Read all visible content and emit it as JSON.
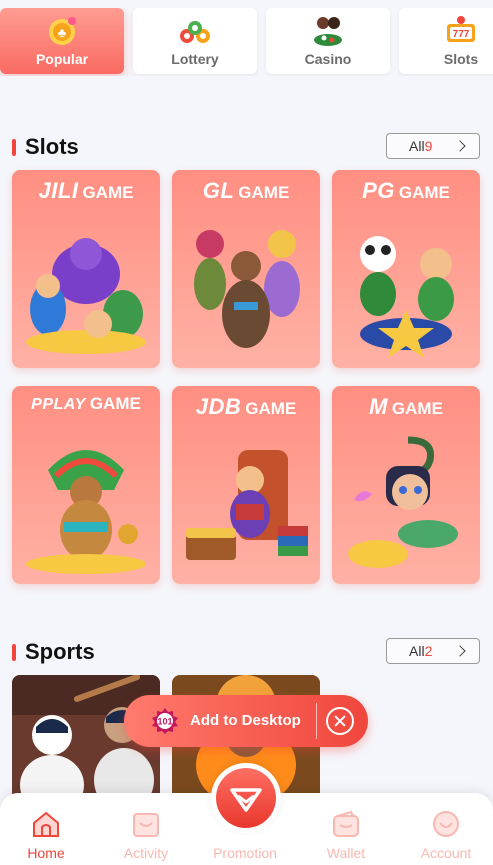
{
  "categories": [
    {
      "label": "Popular",
      "icon": "popular-icon",
      "active": true
    },
    {
      "label": "Lottery",
      "icon": "lottery-icon",
      "active": false
    },
    {
      "label": "Casino",
      "icon": "casino-icon",
      "active": false
    },
    {
      "label": "Slots",
      "icon": "slots-icon",
      "active": false
    }
  ],
  "slots": {
    "title": "Slots",
    "all_label": "All",
    "all_count": "9",
    "games": [
      {
        "brand": "JILI",
        "suffix": "GAME"
      },
      {
        "brand": "GL",
        "suffix": "GAME"
      },
      {
        "brand": "PG",
        "suffix": "GAME"
      },
      {
        "brand": "PPLAY",
        "suffix": "GAME"
      },
      {
        "brand": "JDB",
        "suffix": "GAME"
      },
      {
        "brand": "M",
        "suffix": "GAME"
      }
    ]
  },
  "sports": {
    "title": "Sports",
    "all_label": "All",
    "all_count": "2"
  },
  "add_to_desktop": {
    "badge": "101",
    "label": "Add to Desktop"
  },
  "bottom_nav": [
    {
      "label": "Home",
      "icon": "home-icon",
      "active": true
    },
    {
      "label": "Activity",
      "icon": "activity-icon",
      "active": false
    },
    {
      "label": "Promotion",
      "icon": "promotion-icon",
      "active": false
    },
    {
      "label": "Wallet",
      "icon": "wallet-icon",
      "active": false
    },
    {
      "label": "Account",
      "icon": "account-icon",
      "active": false
    }
  ],
  "colors": {
    "accent": "#f0463c",
    "card_gradient_top": "#ff8f82",
    "card_gradient_bottom": "#ffb1a5",
    "nav_inactive": "#f8b8b1"
  }
}
